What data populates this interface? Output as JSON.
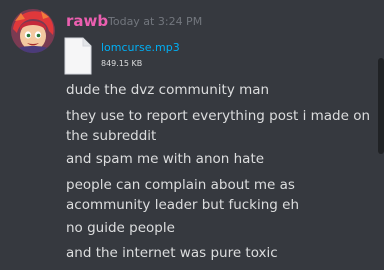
{
  "message": {
    "author": "rawb",
    "author_color": "#ec5fb0",
    "timestamp": "Today at 3:24 PM",
    "avatar_icon": "avatar-icon",
    "attachment": {
      "icon": "file-icon",
      "file_name": "lomcurse.mp3",
      "file_size": "849.15 KB"
    },
    "lines": [
      "dude the dvz community man",
      "they use to report everything post i made on the subreddit",
      "and spam me with anon hate",
      "people can complain about me as acommunity leader but fucking eh",
      "no guide people",
      "and the internet was pure toxic"
    ]
  }
}
